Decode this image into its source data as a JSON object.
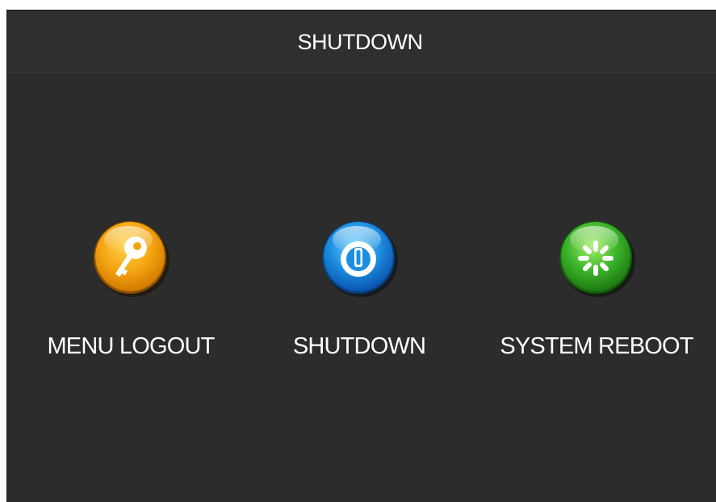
{
  "window": {
    "title": "SHUTDOWN"
  },
  "options": [
    {
      "label": "MENU LOGOUT",
      "icon": "key-icon",
      "color": "#f0a010"
    },
    {
      "label": "SHUTDOWN",
      "icon": "power-icon",
      "color": "#1e8fe0"
    },
    {
      "label": "SYSTEM REBOOT",
      "icon": "reboot-icon",
      "color": "#3cb52a"
    }
  ]
}
